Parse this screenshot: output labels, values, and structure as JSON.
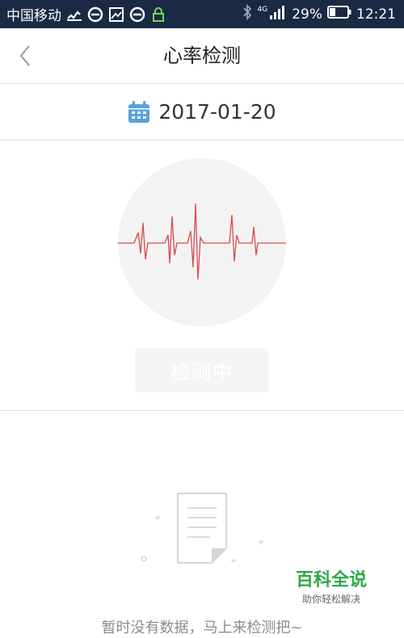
{
  "status_bar": {
    "carrier": "中国移动",
    "network": "4G",
    "battery": "29%",
    "time": "12:21"
  },
  "nav": {
    "title": "心率检测",
    "back_icon": "chevron-left-icon"
  },
  "date": {
    "value": "2017-01-20",
    "icon": "calendar-icon",
    "icon_color": "#5aa0dc"
  },
  "detect": {
    "button_label": "检测中",
    "waveform_color": "#d94a4a"
  },
  "empty": {
    "message": "暂时没有数据，马上来检测把~",
    "icon": "document-icon"
  },
  "watermark": {
    "title": "百科全说",
    "subtitle": "助你轻松解决"
  }
}
